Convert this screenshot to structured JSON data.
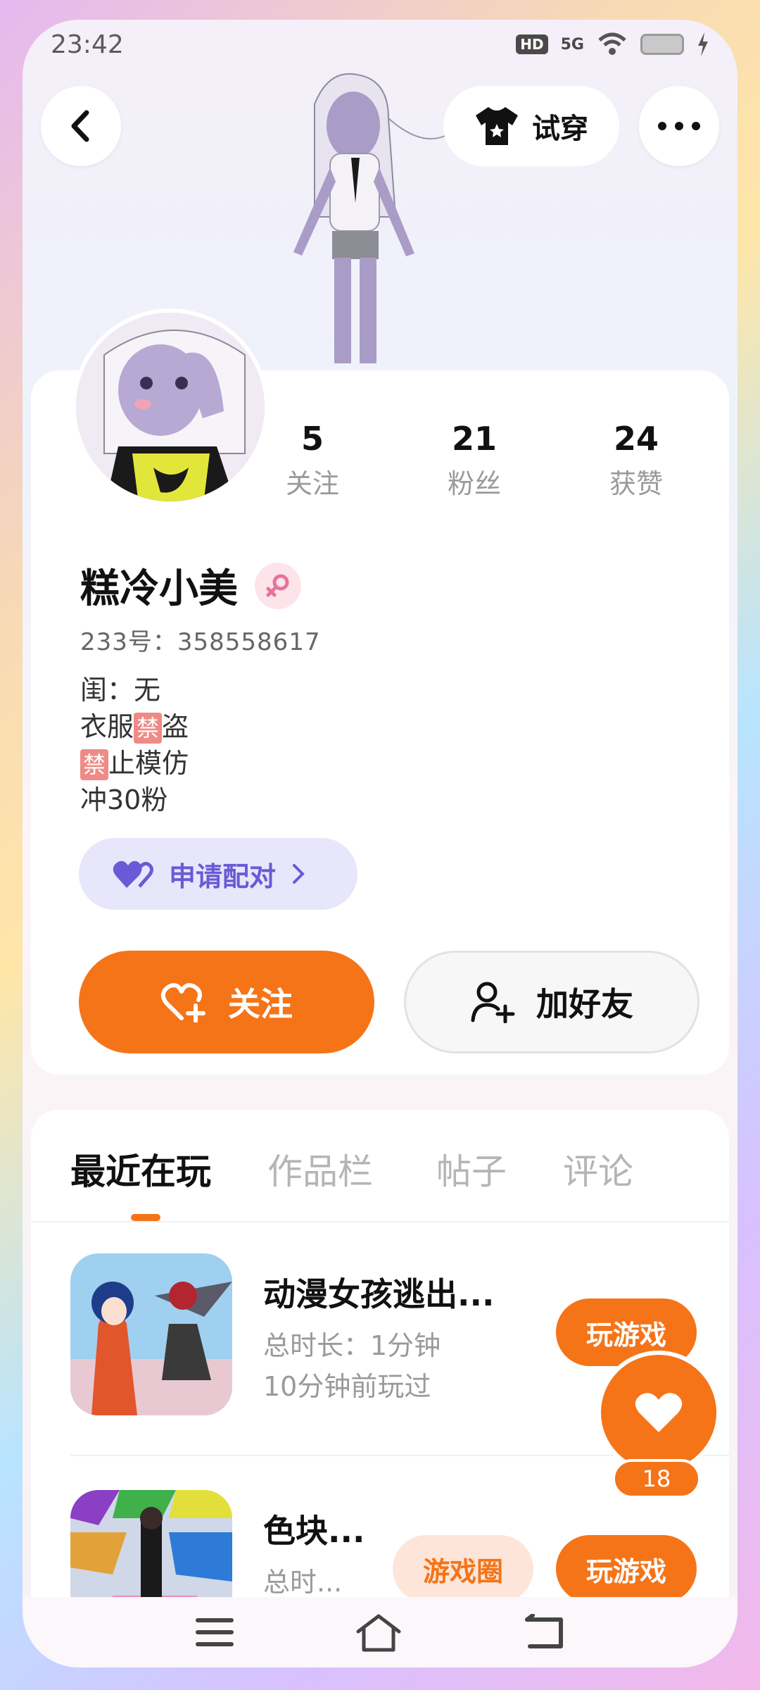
{
  "status": {
    "time": "23:42",
    "network": "5G",
    "hd": "HD"
  },
  "header": {
    "tryon_label": "试穿"
  },
  "profile": {
    "stats": [
      {
        "value": "5",
        "label": "关注"
      },
      {
        "value": "21",
        "label": "粉丝"
      },
      {
        "value": "24",
        "label": "获赞"
      }
    ],
    "name": "糕冷小美",
    "uid": "233号：358558617",
    "bio": {
      "line1": "闺：无",
      "line2a": "衣服",
      "ban": "禁",
      "line2b": "盗",
      "line3": "止模仿",
      "line4": "冲30粉"
    },
    "pair_label": "申请配对",
    "follow_label": "关注",
    "add_friend_label": "加好友"
  },
  "tabs": [
    {
      "label": "最近在玩",
      "active": true
    },
    {
      "label": "作品栏"
    },
    {
      "label": "帖子"
    },
    {
      "label": "评论"
    }
  ],
  "games": [
    {
      "title": "动漫女孩逃出...",
      "duration": "总时长：1分钟",
      "last_played": "10分钟前玩过",
      "play_label": "玩游戏"
    },
    {
      "title": "色块...",
      "duration": "总时...",
      "circle_label": "游戏圈",
      "play_label": "玩游戏"
    }
  ],
  "like_count": "18",
  "colors": {
    "accent": "#f57418",
    "pair_purple": "#6a5ad6"
  }
}
